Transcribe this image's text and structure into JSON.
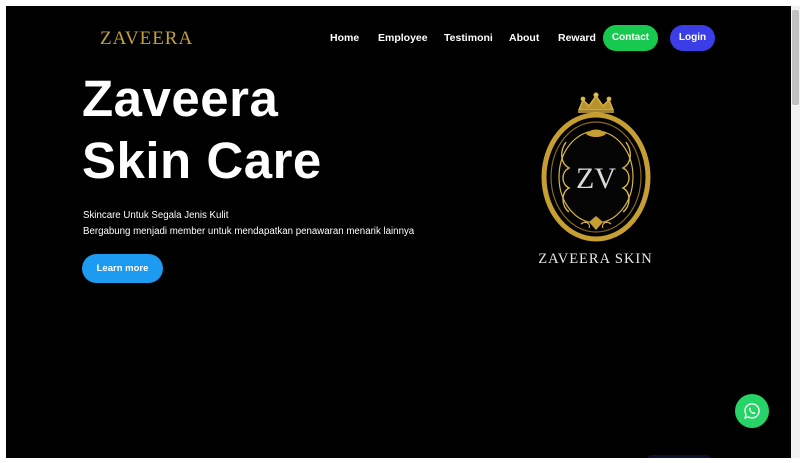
{
  "brand": {
    "name": "ZAVEERA"
  },
  "nav": {
    "links": [
      "Home",
      "Employee",
      "Testimoni",
      "About",
      "Reward"
    ],
    "contact_label": "Contact",
    "login_label": "Login"
  },
  "hero": {
    "title_line1": "Zaveera",
    "title_line2": "Skin Care",
    "subtitle_line1": "Skincare Untuk Segala Jenis Kulit",
    "subtitle_line2": "Bergabung menjadi member untuk mendapatkan penawaran menarik lainnya",
    "cta_label": "Learn more"
  },
  "logo": {
    "monogram": "ZV",
    "caption": "ZAVEERA SKIN"
  },
  "icons": {
    "floating_button": "whatsapp-icon",
    "logo_ornament": "crown-icon"
  },
  "colors": {
    "background": "#000000",
    "brand_gold": "#c2a13c",
    "contact_green": "#18c94f",
    "login_blue": "#3b3ee6",
    "cta_blue": "#1d9bf0",
    "whatsapp_green": "#25d366"
  }
}
